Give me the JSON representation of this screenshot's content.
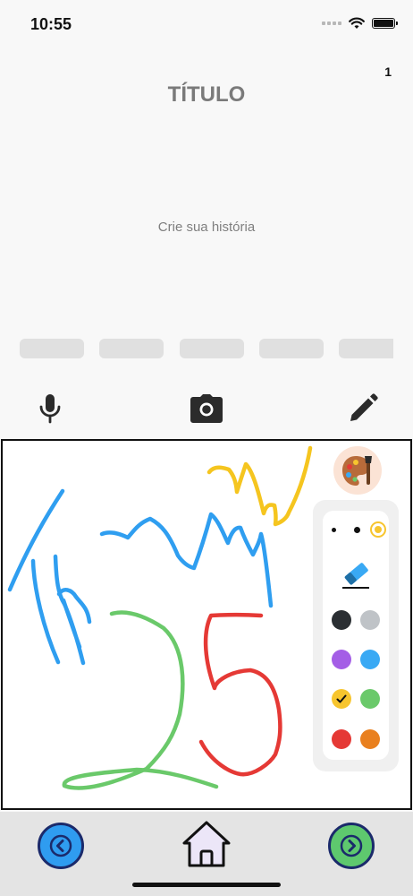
{
  "status_bar": {
    "time": "10:55"
  },
  "page": {
    "number": "1",
    "title": "TÍTULO",
    "story_placeholder": "Crie sua história"
  },
  "thumbnails": {
    "count": 5
  },
  "toolbar": {
    "icons": [
      "microphone-icon",
      "camera-icon",
      "pencil-icon"
    ]
  },
  "drawing_tools": {
    "palette_icon": "palette-icon",
    "brush_sizes": [
      "small",
      "medium",
      "large"
    ],
    "selected_size": "large",
    "eraser_icon": "eraser-icon",
    "colors": [
      "#2b2f33",
      "#bfc3c7",
      "#a45ee6",
      "#39a9f4",
      "#f7c52e",
      "#6ac96a",
      "#e53935",
      "#e9801f"
    ],
    "selected_color": "#f7c52e"
  },
  "bottom_nav": {
    "icons": [
      "back-arrow-icon",
      "home-icon",
      "forward-arrow-icon"
    ],
    "back_color": "#2f9cf0",
    "forward_color": "#5ec86e"
  }
}
